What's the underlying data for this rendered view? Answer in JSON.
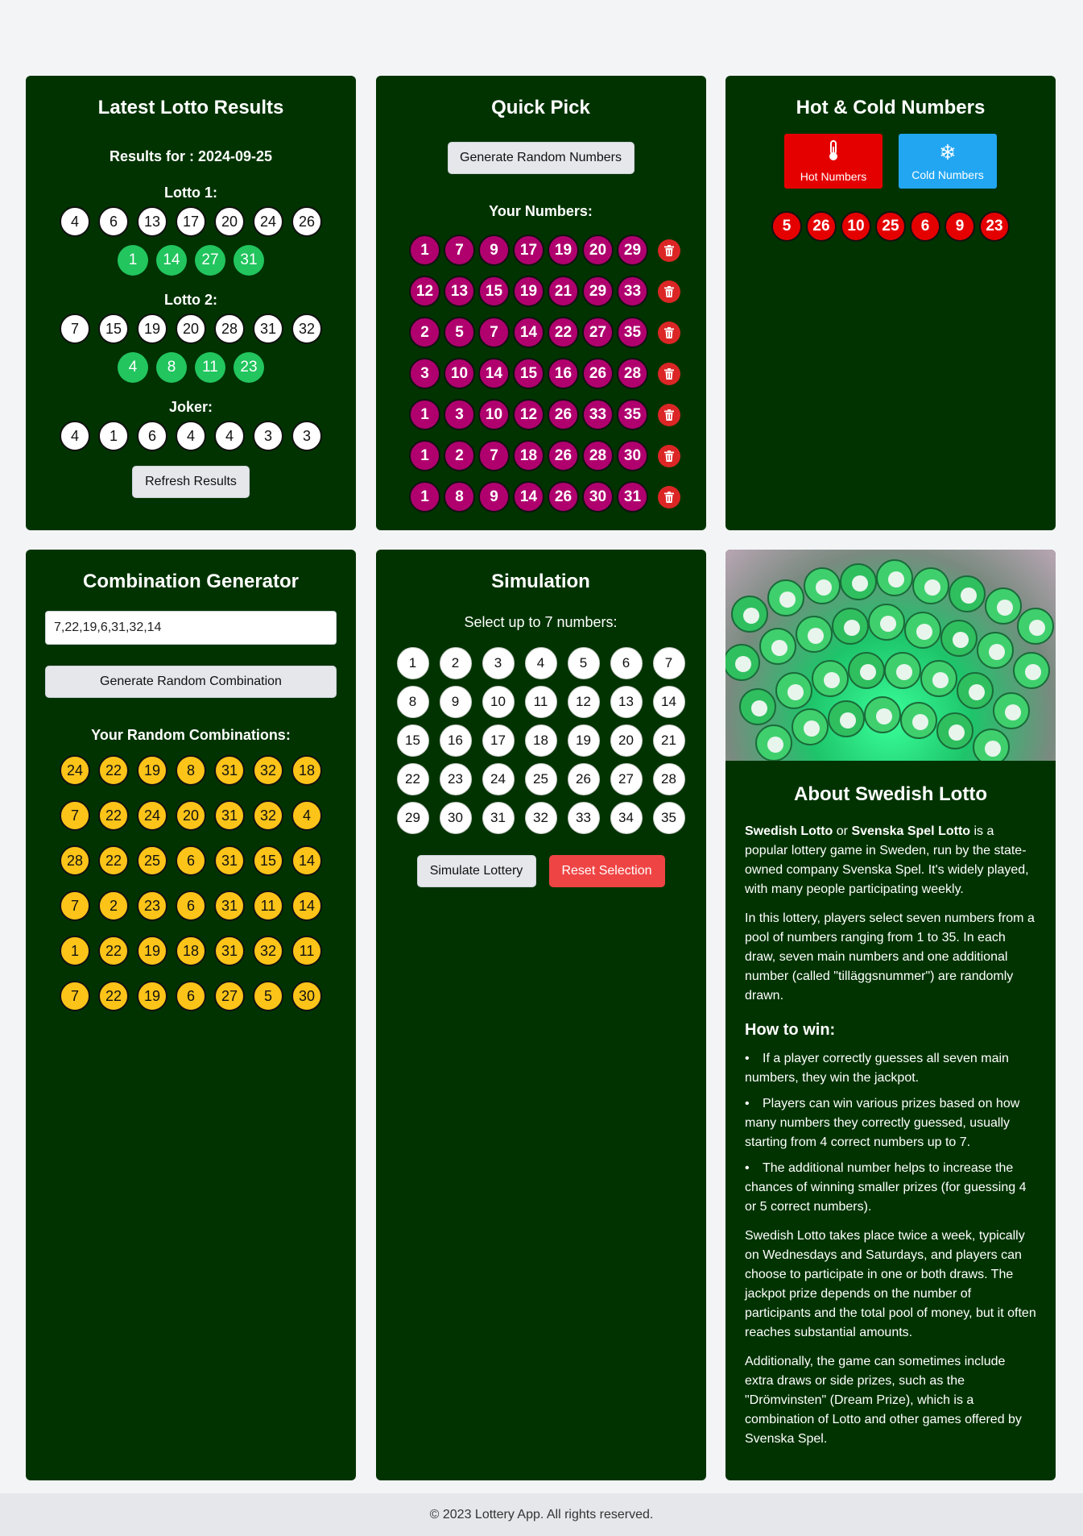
{
  "latest": {
    "title": "Latest Lotto Results",
    "results_for": "Results for : 2024-09-25",
    "lotto1_label": "Lotto 1:",
    "lotto1_main": [
      "4",
      "6",
      "13",
      "17",
      "20",
      "24",
      "26"
    ],
    "lotto1_extra": [
      "1",
      "14",
      "27",
      "31"
    ],
    "lotto2_label": "Lotto 2:",
    "lotto2_main": [
      "7",
      "15",
      "19",
      "20",
      "28",
      "31",
      "32"
    ],
    "lotto2_extra": [
      "4",
      "8",
      "11",
      "23"
    ],
    "joker_label": "Joker:",
    "joker": [
      "4",
      "1",
      "6",
      "4",
      "4",
      "3",
      "3"
    ],
    "refresh_label": "Refresh Results"
  },
  "quick": {
    "title": "Quick Pick",
    "generate_label": "Generate Random Numbers",
    "your_numbers_label": "Your Numbers:",
    "rows": [
      [
        "1",
        "7",
        "9",
        "17",
        "19",
        "20",
        "29"
      ],
      [
        "12",
        "13",
        "15",
        "19",
        "21",
        "29",
        "33"
      ],
      [
        "2",
        "5",
        "7",
        "14",
        "22",
        "27",
        "35"
      ],
      [
        "3",
        "10",
        "14",
        "15",
        "16",
        "26",
        "28"
      ],
      [
        "1",
        "3",
        "10",
        "12",
        "26",
        "33",
        "35"
      ],
      [
        "1",
        "2",
        "7",
        "18",
        "26",
        "28",
        "30"
      ],
      [
        "1",
        "8",
        "9",
        "14",
        "26",
        "30",
        "31"
      ]
    ]
  },
  "hotcold": {
    "title": "Hot & Cold Numbers",
    "hot_label": "Hot Numbers",
    "cold_label": "Cold Numbers",
    "hot_icon": "thermometer-icon",
    "cold_icon": "snowflake-icon",
    "numbers": [
      "5",
      "26",
      "10",
      "25",
      "6",
      "9",
      "23"
    ]
  },
  "combo": {
    "title": "Combination Generator",
    "input_value": "7,22,19,6,31,32,14",
    "generate_label": "Generate Random Combination",
    "your_label": "Your Random Combinations:",
    "rows": [
      [
        "24",
        "22",
        "19",
        "8",
        "31",
        "32",
        "18"
      ],
      [
        "7",
        "22",
        "24",
        "20",
        "31",
        "32",
        "4"
      ],
      [
        "28",
        "22",
        "25",
        "6",
        "31",
        "15",
        "14"
      ],
      [
        "7",
        "2",
        "23",
        "6",
        "31",
        "11",
        "14"
      ],
      [
        "1",
        "22",
        "19",
        "18",
        "31",
        "32",
        "11"
      ],
      [
        "7",
        "22",
        "19",
        "6",
        "27",
        "5",
        "30"
      ]
    ]
  },
  "simulation": {
    "title": "Simulation",
    "select_label": "Select up to 7 numbers:",
    "numbers": [
      "1",
      "2",
      "3",
      "4",
      "5",
      "6",
      "7",
      "8",
      "9",
      "10",
      "11",
      "12",
      "13",
      "14",
      "15",
      "16",
      "17",
      "18",
      "19",
      "20",
      "21",
      "22",
      "23",
      "24",
      "25",
      "26",
      "27",
      "28",
      "29",
      "30",
      "31",
      "32",
      "33",
      "34",
      "35"
    ],
    "simulate_label": "Simulate Lottery",
    "reset_label": "Reset Selection"
  },
  "about": {
    "title": "About Swedish Lotto",
    "p1_b1": "Swedish Lotto",
    "p1_or": " or ",
    "p1_b2": "Svenska Spel Lotto",
    "p1_rest": " is a popular lottery game in Sweden, run by the state-owned company Svenska Spel. It's widely played, with many people participating weekly.",
    "p2": "In this lottery, players select seven numbers from a pool of numbers ranging from 1 to 35. In each draw, seven main numbers and one additional number (called \"tilläggsnummer\") are randomly drawn.",
    "how_title": "How to win:",
    "bullets": [
      "If a player correctly guesses all seven main numbers, they win the jackpot.",
      "Players can win various prizes based on how many numbers they correctly guessed, usually starting from 4 correct numbers up to 7.",
      "The additional number helps to increase the chances of winning smaller prizes (for guessing 4 or 5 correct numbers)."
    ],
    "p3": "Swedish Lotto takes place twice a week, typically on Wednesdays and Saturdays, and players can choose to participate in one or both draws. The jackpot prize depends on the number of participants and the total pool of money, but it often reaches substantial amounts.",
    "p4": "Additionally, the game can sometimes include extra draws or side prizes, such as the \"Drömvinsten\" (Dream Prize), which is a combination of Lotto and other games offered by Svenska Spel."
  },
  "footer": {
    "text": "© 2023 Lottery App. All rights reserved."
  },
  "colors": {
    "card_bg": "#003300",
    "page_bg": "#f3f4f6",
    "green_ball": "#22c55e",
    "purple_ball": "#b0006e",
    "yellow_ball": "#fcc419",
    "hot_red": "#e50000",
    "cold_blue": "#22a6f2",
    "reset_red": "#ef4444"
  }
}
